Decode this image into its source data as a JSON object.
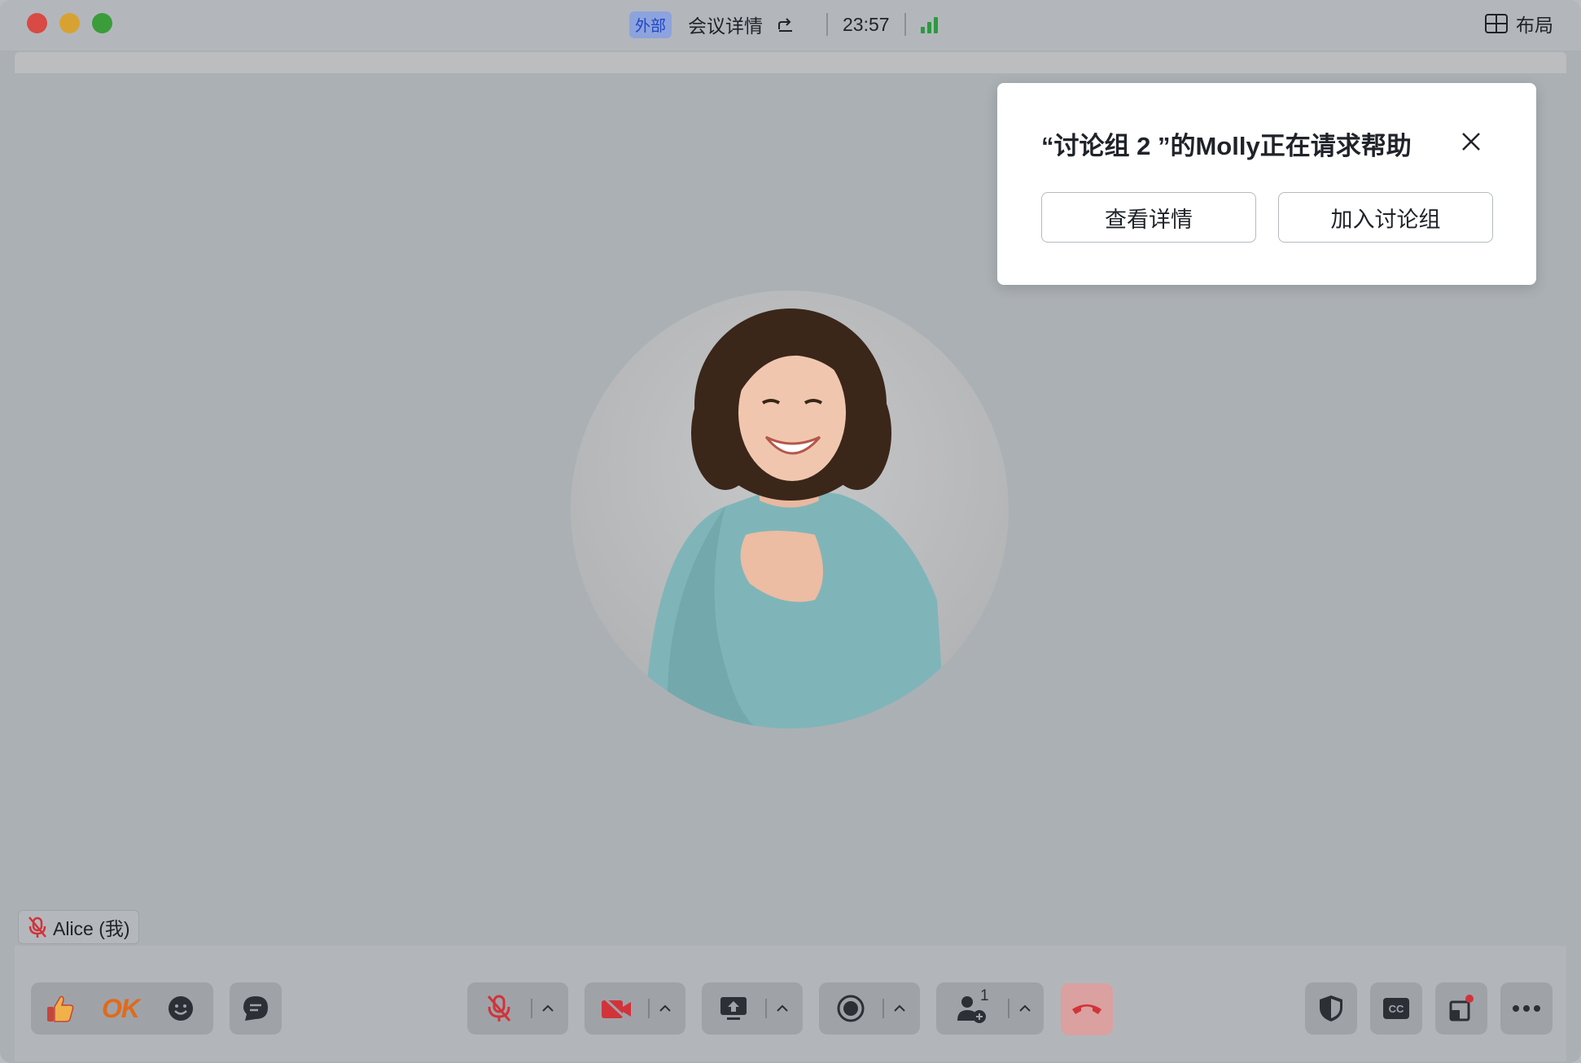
{
  "titlebar": {
    "tag": "外部",
    "title": "会议详情",
    "timer": "23:57",
    "layout_label": "布局"
  },
  "popup": {
    "message": "“讨论组 2 ”的Molly正在请求帮助",
    "view_details": "查看详情",
    "join_group": "加入讨论组"
  },
  "participant": {
    "name": "Alice (我)"
  },
  "reactions": {
    "ok": "OK"
  },
  "participants_count": "1",
  "colors": {
    "accent_green": "#2c9a3f",
    "danger_red": "#d0343a",
    "tag_blue": "#1f47c4"
  },
  "icons": [
    "thumbs-up-icon",
    "ok-icon",
    "emoji-icon",
    "chat-icon",
    "mic-muted-icon",
    "camera-off-icon",
    "share-screen-icon",
    "record-icon",
    "invite-participant-icon",
    "hang-up-icon",
    "security-icon",
    "captions-icon",
    "layout-window-icon",
    "more-icon"
  ]
}
